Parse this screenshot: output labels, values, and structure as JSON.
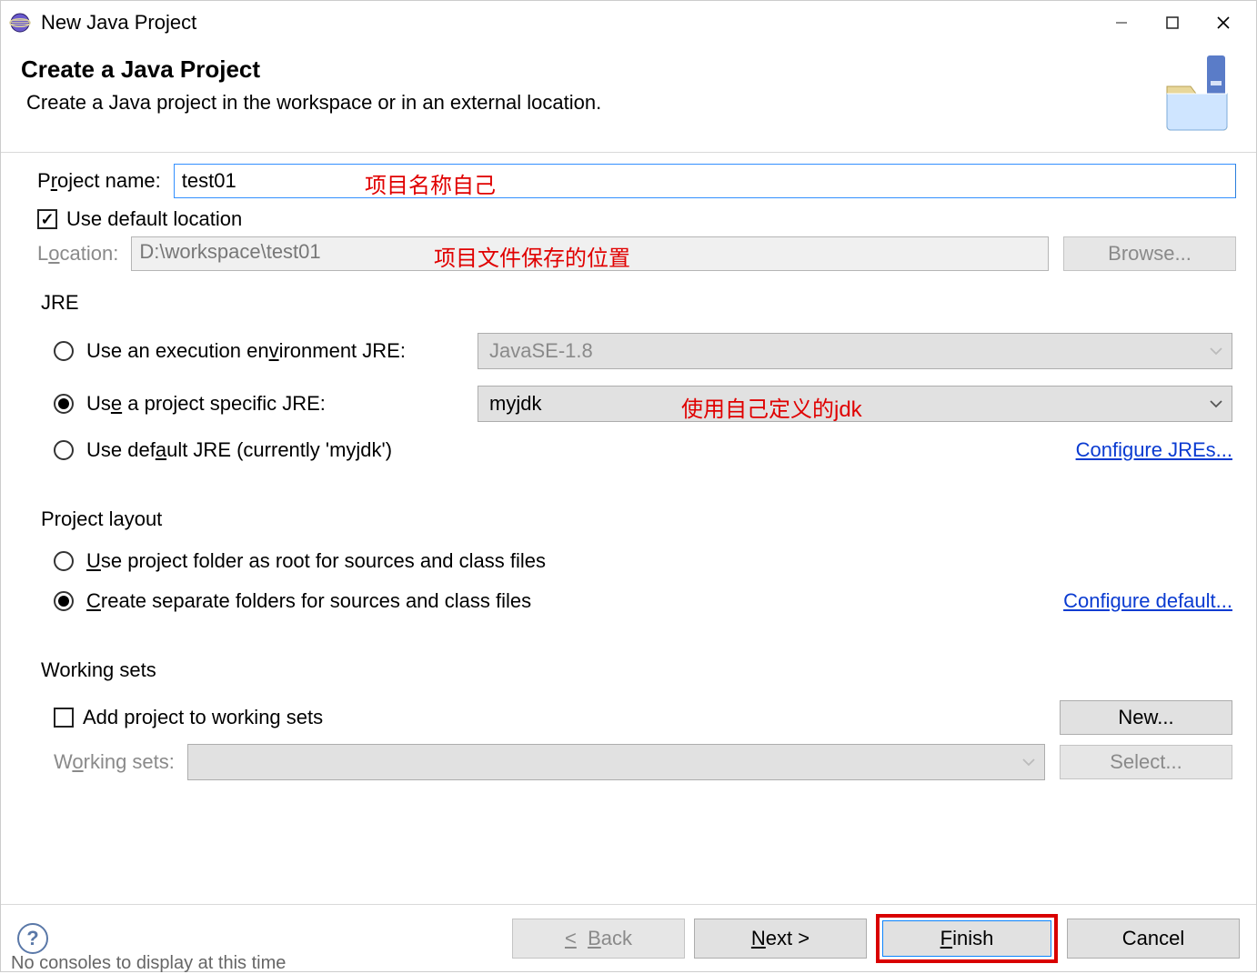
{
  "titlebar": {
    "title": "New Java Project"
  },
  "banner": {
    "title": "Create a Java Project",
    "desc": "Create a Java project in the workspace or in an external location."
  },
  "project": {
    "name_label_pre": "P",
    "name_label_u": "r",
    "name_label_post": "oject name:",
    "name_value": "test01",
    "use_default_label": "Use default location",
    "location_label_pre": "L",
    "location_label_u": "o",
    "location_label_post": "cation:",
    "location_value": "D:\\workspace\\test01",
    "browse_label": "Browse..."
  },
  "annotations": {
    "name": "项目名称自己",
    "location": "项目文件保存的位置",
    "jre": "使用自己定义的jdk"
  },
  "jre": {
    "group_title": "JRE",
    "exec_env_pre": "Use an execution en",
    "exec_env_u": "v",
    "exec_env_post": "ironment JRE:",
    "exec_env_value": "JavaSE-1.8",
    "specific_pre": "Us",
    "specific_u": "e",
    "specific_post": " a project specific JRE:",
    "specific_value": "myjdk",
    "default_pre": "Use def",
    "default_u": "a",
    "default_post": "ult JRE (currently 'myjdk')",
    "configure_link": "Configure JREs..."
  },
  "layout": {
    "group_title": "Project layout",
    "root_pre": "",
    "root_u": "U",
    "root_post": "se project folder as root for sources and class files",
    "sep_pre": "",
    "sep_u": "C",
    "sep_post": "reate separate folders for sources and class files",
    "configure_link": "Configure default..."
  },
  "workingsets": {
    "group_title": "Working sets",
    "add_label": "Add project to working sets",
    "new_label": "New...",
    "combo_pre": "W",
    "combo_u": "o",
    "combo_post": "rking sets:",
    "select_label": "Select..."
  },
  "footer": {
    "back": "< Back",
    "next": "Next >",
    "finish": "Finish",
    "cancel": "Cancel"
  },
  "hidden_text": "No consoles to display at this time"
}
